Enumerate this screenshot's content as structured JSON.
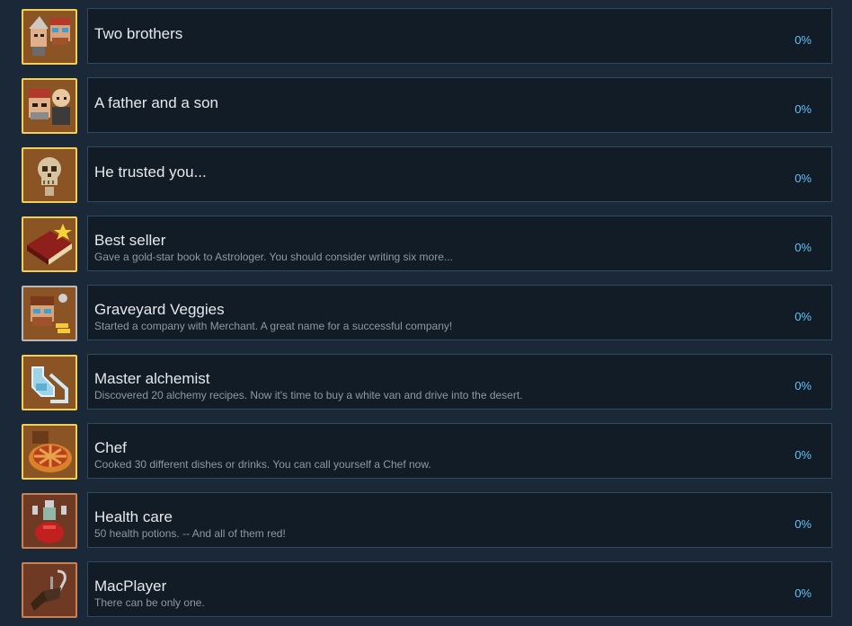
{
  "achievements": [
    {
      "title": "Two brothers",
      "description": "",
      "percent": "0%",
      "icon": "two-brothers-icon",
      "frame": "gold"
    },
    {
      "title": "A father and a son",
      "description": "",
      "percent": "0%",
      "icon": "father-son-icon",
      "frame": "gold"
    },
    {
      "title": "He trusted you...",
      "description": "",
      "percent": "0%",
      "icon": "skull-icon",
      "frame": "gold"
    },
    {
      "title": "Best seller",
      "description": "Gave a gold-star book to Astrologer. You should consider writing six more...",
      "percent": "0%",
      "icon": "gold-star-book-icon",
      "frame": "gold"
    },
    {
      "title": "Graveyard Veggies",
      "description": "Started a company with Merchant. A great name for a successful company!",
      "percent": "0%",
      "icon": "merchant-icon",
      "frame": "silver"
    },
    {
      "title": "Master alchemist",
      "description": "Discovered 20 alchemy recipes. Now it's time to buy a white van and drive into the desert.",
      "percent": "0%",
      "icon": "alchemy-flask-icon",
      "frame": "gold"
    },
    {
      "title": "Chef",
      "description": "Cooked 30 different dishes or drinks. You can call yourself a Chef now.",
      "percent": "0%",
      "icon": "pie-icon",
      "frame": "gold"
    },
    {
      "title": "Health care",
      "description": "50 health potions. -- And all of them red!",
      "percent": "0%",
      "icon": "health-potion-icon",
      "frame": "copper"
    },
    {
      "title": "MacPlayer",
      "description": "There can be only one.",
      "percent": "0%",
      "icon": "hook-hand-icon",
      "frame": "copper"
    }
  ]
}
